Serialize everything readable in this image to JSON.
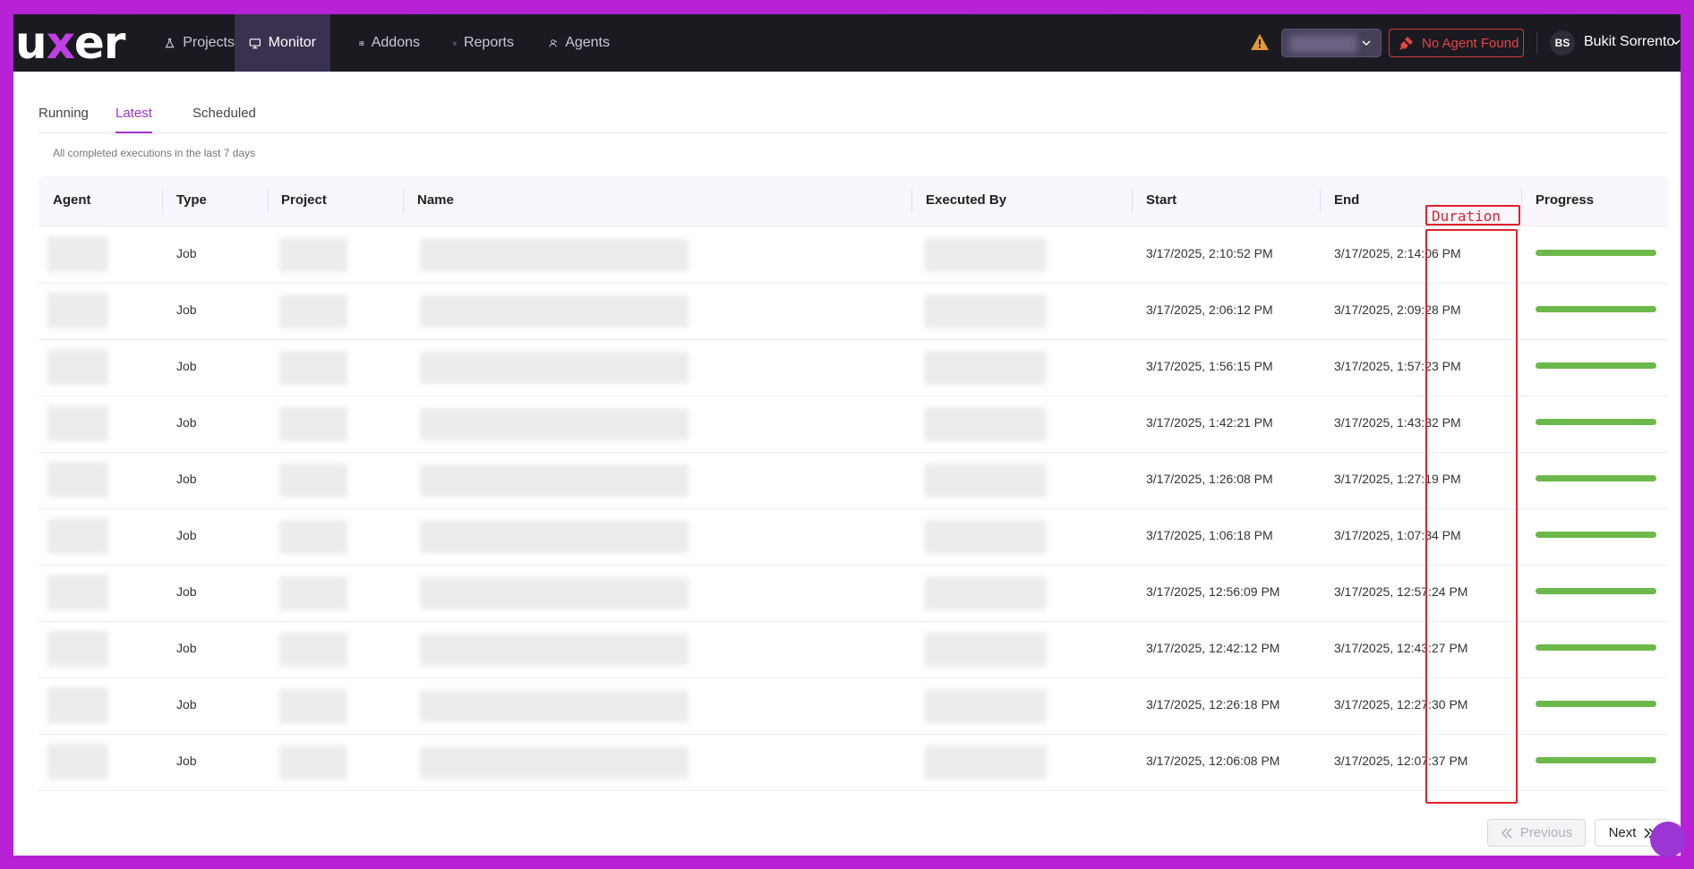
{
  "header": {
    "logo": {
      "u": "u",
      "x": "x",
      "er": "er"
    },
    "nav": [
      {
        "label": "Projects",
        "icon": "flask-icon"
      },
      {
        "label": "Monitor",
        "icon": "monitor-icon",
        "active": true
      },
      {
        "label": "Addons",
        "icon": "addons-icon"
      },
      {
        "label": "Reports",
        "icon": "document-icon"
      },
      {
        "label": "Agents",
        "icon": "agents-icon"
      }
    ],
    "warning_icon": "warning-icon",
    "agent_status": "No Agent Found",
    "user": {
      "initials": "BS",
      "name": "Bukit Sorrento"
    }
  },
  "tabs": [
    {
      "label": "Running"
    },
    {
      "label": "Latest",
      "active": true
    },
    {
      "label": "Scheduled"
    }
  ],
  "subtitle": "All completed executions in the last 7 days",
  "table": {
    "columns": [
      "Agent",
      "Type",
      "Project",
      "Name",
      "Executed By",
      "Start",
      "End",
      "Duration",
      "Progress"
    ],
    "rows": [
      {
        "type": "Job",
        "start": "3/17/2025, 2:10:52 PM",
        "end": "3/17/2025, 2:14:06 PM",
        "progress": 100
      },
      {
        "type": "Job",
        "start": "3/17/2025, 2:06:12 PM",
        "end": "3/17/2025, 2:09:28 PM",
        "progress": 100
      },
      {
        "type": "Job",
        "start": "3/17/2025, 1:56:15 PM",
        "end": "3/17/2025, 1:57:23 PM",
        "progress": 100
      },
      {
        "type": "Job",
        "start": "3/17/2025, 1:42:21 PM",
        "end": "3/17/2025, 1:43:32 PM",
        "progress": 100
      },
      {
        "type": "Job",
        "start": "3/17/2025, 1:26:08 PM",
        "end": "3/17/2025, 1:27:19 PM",
        "progress": 100
      },
      {
        "type": "Job",
        "start": "3/17/2025, 1:06:18 PM",
        "end": "3/17/2025, 1:07:34 PM",
        "progress": 100
      },
      {
        "type": "Job",
        "start": "3/17/2025, 12:56:09 PM",
        "end": "3/17/2025, 12:57:24 PM",
        "progress": 100
      },
      {
        "type": "Job",
        "start": "3/17/2025, 12:42:12 PM",
        "end": "3/17/2025, 12:43:27 PM",
        "progress": 100
      },
      {
        "type": "Job",
        "start": "3/17/2025, 12:26:18 PM",
        "end": "3/17/2025, 12:27:30 PM",
        "progress": 100
      },
      {
        "type": "Job",
        "start": "3/17/2025, 12:06:08 PM",
        "end": "3/17/2025, 12:07:37 PM",
        "progress": 100
      }
    ]
  },
  "annotation": {
    "label": "Duration",
    "color": "#e0222b"
  },
  "pagination": {
    "previous": "Previous",
    "next": "Next"
  },
  "colors": {
    "accent": "#a52fd1",
    "progress": "#6db84a",
    "header_bg": "#1b1a21",
    "error": "#e24545"
  }
}
